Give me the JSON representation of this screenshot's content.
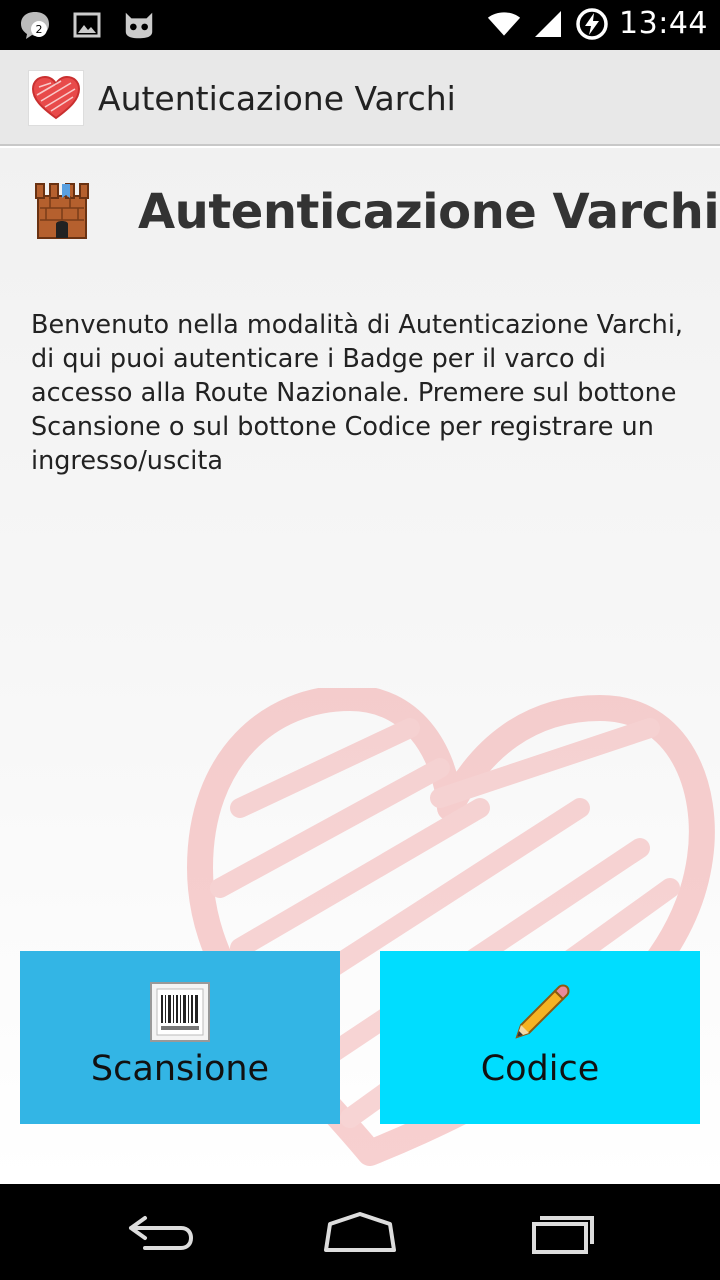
{
  "status_bar": {
    "time": "13:44",
    "notification_count": "2",
    "icons": [
      "chat-notification-icon",
      "image-icon",
      "robot-icon",
      "wifi-icon",
      "signal-icon",
      "battery-charging-icon"
    ]
  },
  "action_bar": {
    "title": "Autenticazione Varchi",
    "app_icon": "heart-icon"
  },
  "main": {
    "heading": "Autenticazione Varchi",
    "heading_icon": "castle-icon",
    "description": "Benvenuto nella modalità di Autenticazione Varchi, di qui puoi autenticare i Badge per il varco di accesso alla Route Nazionale. Premere sul bottone Scansione o sul bottone Codice per registrare un ingresso/uscita",
    "buttons": [
      {
        "label": "Scansione",
        "icon": "barcode-icon",
        "color": "#33b5e5"
      },
      {
        "label": "Codice",
        "icon": "pencil-icon",
        "color": "#00ddff"
      }
    ]
  },
  "nav_bar": {
    "buttons": [
      "back-icon",
      "home-icon",
      "recent-apps-icon"
    ]
  },
  "colors": {
    "status_bar": "#000000",
    "action_bar": "#e8e8e8",
    "accent_heart": "#e85050"
  }
}
